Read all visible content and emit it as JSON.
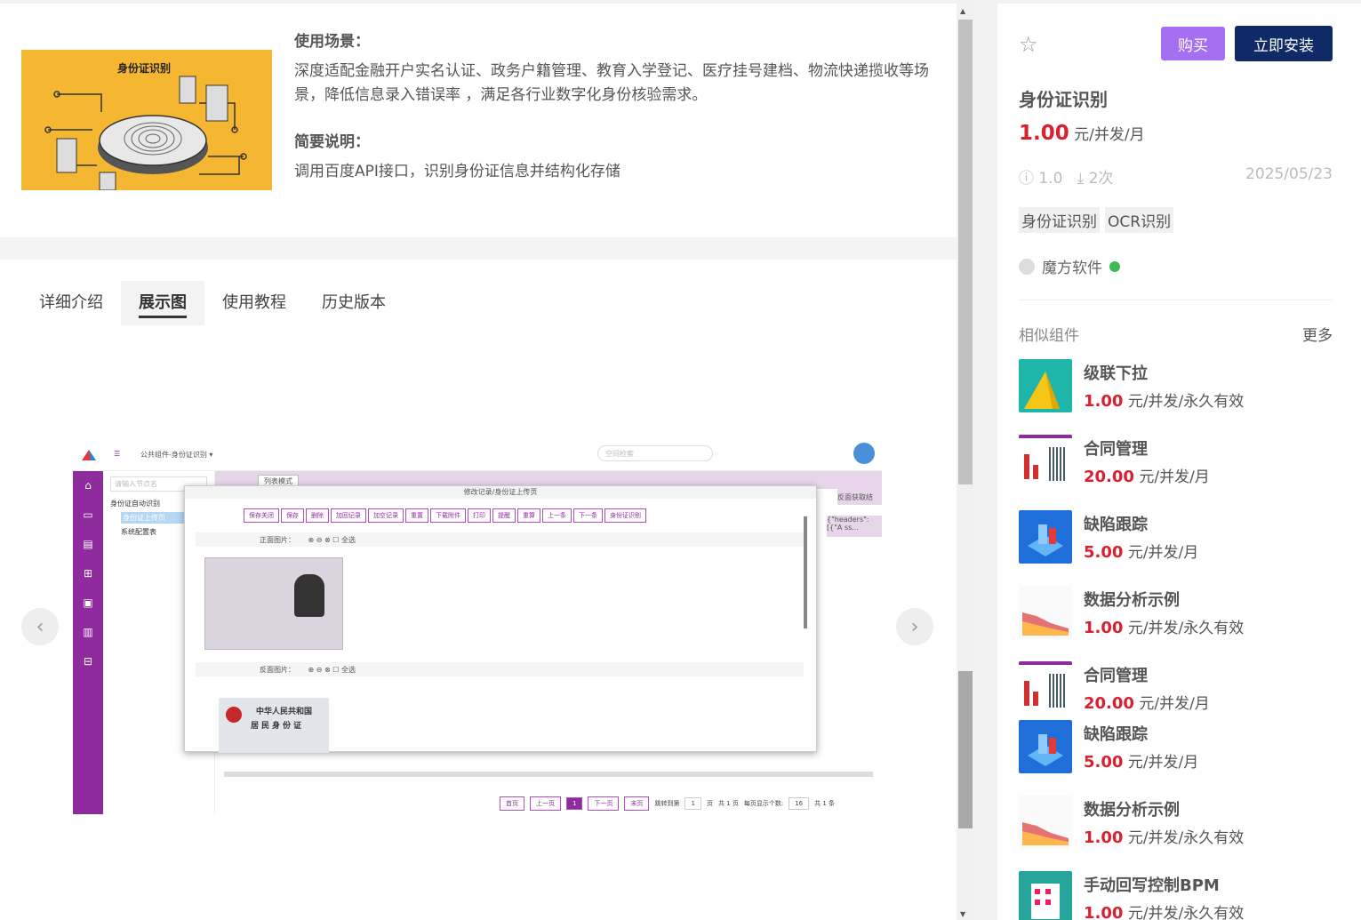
{
  "intro": {
    "cover_title": "身份证识别",
    "scene_heading": "使用场景：",
    "scene_text": "深度适配金融开户实名认证、政务户籍管理、教育入学登记、医疗挂号建档、物流快递揽收等场景，降低信息录入错误率 ，满足各行业数字化身份核验需求。",
    "brief_heading": "简要说明：",
    "brief_text": "调用百度API接口，识别身份证信息并结构化存储"
  },
  "tabs": [
    {
      "label": "详细介绍",
      "active": false
    },
    {
      "label": "展示图",
      "active": true
    },
    {
      "label": "使用教程",
      "active": false
    },
    {
      "label": "历史版本",
      "active": false
    }
  ],
  "carousel": {
    "prev_icon": "chevron-left-icon",
    "next_icon": "chevron-right-icon",
    "prev_glyph": "‹",
    "next_glyph": "›"
  },
  "shot": {
    "app_title": "公共组件-身份证识别 ▾",
    "search_placeholder": "空间检索",
    "tree_search": "请输入节点名",
    "tree_root": "身份证自动识别",
    "tree_items": [
      "身份证上传页",
      "系统配置表"
    ],
    "view_mode": "列表模式",
    "modal_title": "修改记录/身份证上传页",
    "modal_buttons": [
      "保存关闭",
      "保存",
      "删除",
      "加回记录",
      "加空记录",
      "重置",
      "下载附件",
      "打印",
      "提醒",
      "重算",
      "上一条",
      "下一条",
      "身份证识别"
    ],
    "front_label": "正面图片：",
    "back_label": "反面图片：",
    "select_all": "全选",
    "grid_header": "反面获取结",
    "grid_cell": "{\"headers\":[{\"A ss...",
    "id_back_line1": "中华人民共和国",
    "id_back_line2": "居民身份证",
    "pager": {
      "first": "首页",
      "prev": "上一页",
      "current": "1",
      "next": "下一页",
      "last": "末页",
      "jump": "跳转到第",
      "jump_val": "1",
      "page_unit": "页",
      "total_pages": "共 1 页",
      "per_page": "每页显示个数:",
      "per_page_val": "16",
      "total": "共 1 条"
    }
  },
  "right": {
    "star_icon": "star-icon",
    "buy_label": "购买",
    "install_label": "立即安装",
    "title": "身份证识别",
    "price": "1.00",
    "price_unit": "元/并发/月",
    "version": "ⓘ 1.0",
    "downloads": "⤓ 2次",
    "date": "2025/05/23",
    "tags": [
      "身份证识别",
      "OCR识别"
    ],
    "author": "魔方软件",
    "similar_heading": "相似组件",
    "more_label": "更多",
    "similar": [
      {
        "name": "级联下拉",
        "price": "1.00",
        "unit": "元/并发/永久有效",
        "thumb": "teal"
      },
      {
        "name": "合同管理",
        "price": "20.00",
        "unit": "元/并发/月",
        "thumb": "chart"
      },
      {
        "name": "缺陷跟踪",
        "price": "5.00",
        "unit": "元/并发/月",
        "thumb": "blue"
      },
      {
        "name": "数据分析示例",
        "price": "1.00",
        "unit": "元/并发/永久有效",
        "thumb": "area"
      },
      {
        "name": "合同管理",
        "price": "20.00",
        "unit": "元/并发/月",
        "thumb": "chart"
      },
      {
        "name": "缺陷跟踪",
        "price": "5.00",
        "unit": "元/并发/月",
        "thumb": "blue"
      },
      {
        "name": "数据分析示例",
        "price": "1.00",
        "unit": "元/并发/永久有效",
        "thumb": "area"
      },
      {
        "name": "手动回写控制BPM",
        "price": "1.00",
        "unit": "元/并发/永久有效",
        "thumb": "bpm"
      }
    ]
  }
}
